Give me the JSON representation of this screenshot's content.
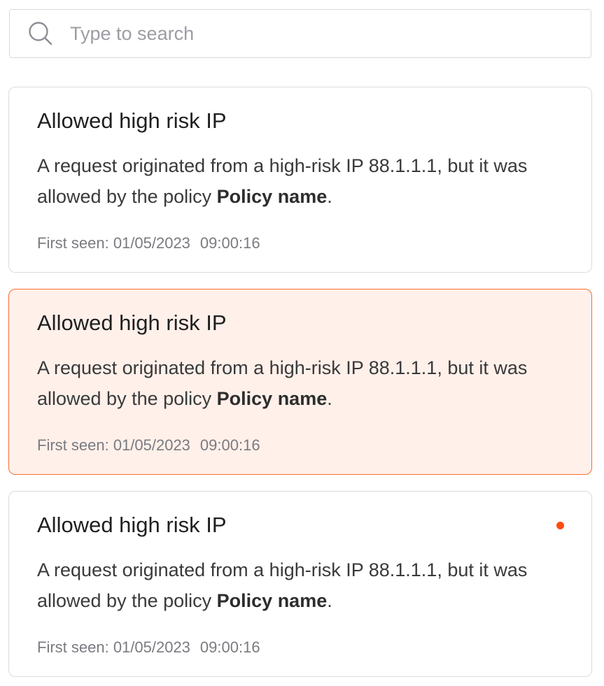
{
  "search": {
    "placeholder": "Type to search",
    "icon": "search-icon"
  },
  "colors": {
    "accent": "#ff6a2b",
    "selected_background": "#fff0ea",
    "unread_dot": "#ff4d0f"
  },
  "alerts": [
    {
      "title": "Allowed high risk IP",
      "description_text": "A request originated from a high-risk IP 88.1.1.1, but it was allowed by the policy ",
      "policy": "Policy name",
      "description_end": ".",
      "first_seen_label": "First seen: ",
      "date": "01/05/2023",
      "time": "09:00:16",
      "selected": false,
      "unread": false
    },
    {
      "title": "Allowed high risk IP",
      "description_text": "A request originated from a high-risk IP 88.1.1.1, but it was allowed by the policy ",
      "policy": "Policy name",
      "description_end": ".",
      "first_seen_label": "First seen: ",
      "date": "01/05/2023",
      "time": "09:00:16",
      "selected": true,
      "unread": false
    },
    {
      "title": "Allowed high risk IP",
      "description_text": "A request originated from a high-risk IP 88.1.1.1, but it was allowed by the policy ",
      "policy": "Policy name",
      "description_end": ".",
      "first_seen_label": "First seen: ",
      "date": "01/05/2023",
      "time": "09:00:16",
      "selected": false,
      "unread": true
    }
  ]
}
